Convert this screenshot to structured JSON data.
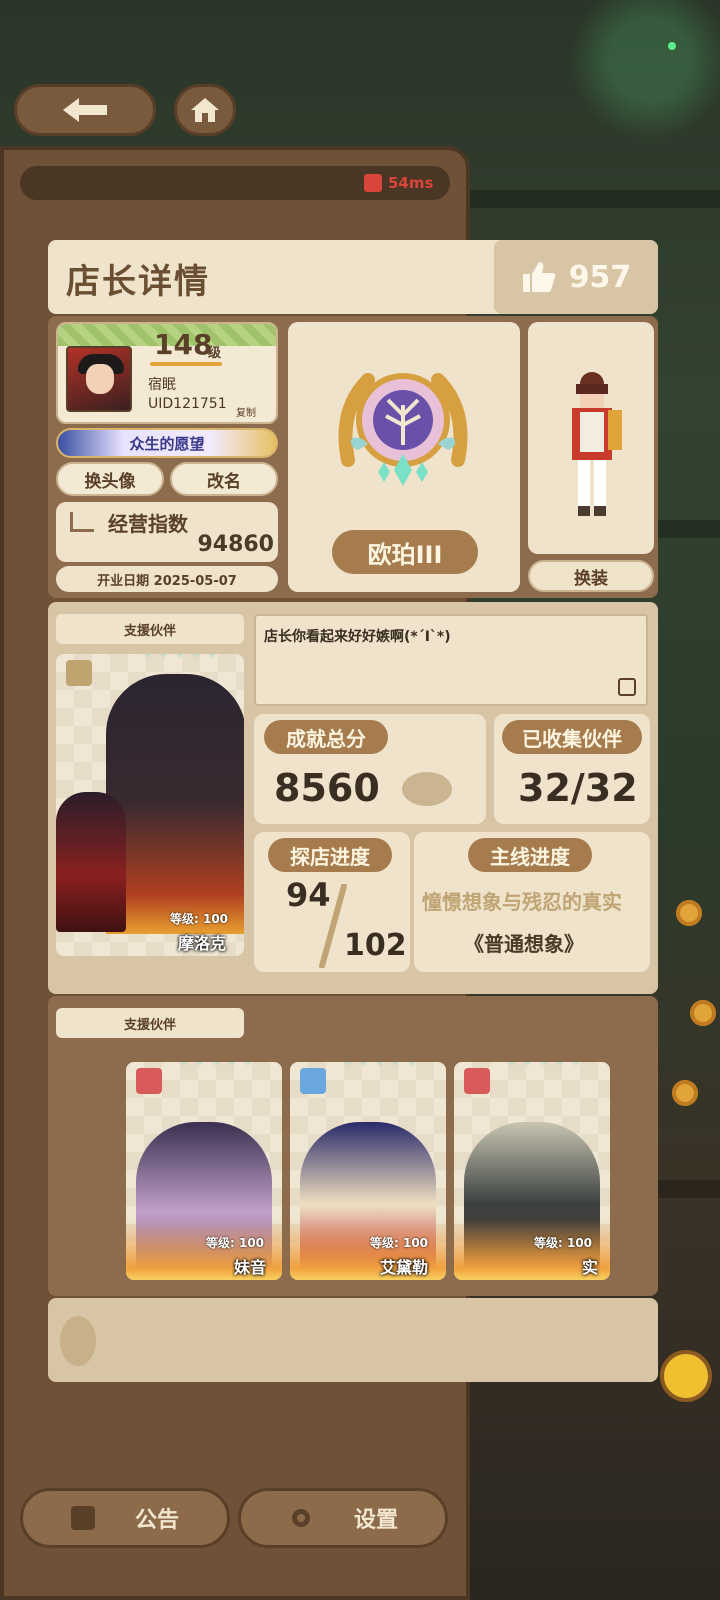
{
  "top_nav": {
    "back_icon": "arrow-left-icon",
    "home_icon": "home-icon",
    "ping": "54ms"
  },
  "header": {
    "title": "店长详情",
    "likes": "957"
  },
  "profile": {
    "level": "148",
    "level_unit": "级",
    "name": "宿眠",
    "uid": "UID121751",
    "copy_label": "复制",
    "title_badge": "众生的愿望",
    "change_avatar": "换头像",
    "rename": "改名",
    "business_label": "经营指数",
    "business_value": "94860",
    "open_date": "开业日期 2025-05-07"
  },
  "rank": {
    "label": "欧珀III"
  },
  "outfit": {
    "button": "换装"
  },
  "main_partner": {
    "section_label": "支援伙伴",
    "level_text": "等级: 100",
    "name": "摩洛克",
    "stars": "✦✦✦✦✦"
  },
  "quote": "店长你看起来好好嫉啊(*´Ι`*)",
  "stats": {
    "achievement_label": "成就总分",
    "achievement_value": "8560",
    "collected_label": "已收集伙伴",
    "collected_value": "32/32",
    "explore_label": "探店进度",
    "explore_current": "94",
    "explore_total": "102",
    "story_label": "主线进度",
    "story_chapter": "憧憬想象与残忍的真实",
    "story_difficulty": "《普通想象》"
  },
  "support_partners": {
    "section_label": "支援伙伴",
    "cards": [
      {
        "level_text": "等级: 100",
        "name": "妹音",
        "stars": "✦✦✦✦✦"
      },
      {
        "level_text": "等级: 100",
        "name": "艾黛勒",
        "stars": "✦✦✦✦✦"
      },
      {
        "level_text": "等级: 100",
        "name": "实",
        "stars": "✦✦✦✦✦"
      }
    ]
  },
  "bottom": {
    "notice": "公告",
    "settings": "设置"
  },
  "colors": {
    "panel_brown": "#8c6c4c",
    "card_cream": "#efe3cc",
    "pill_brown": "#a67c4e",
    "ping_red": "#d9453a"
  }
}
